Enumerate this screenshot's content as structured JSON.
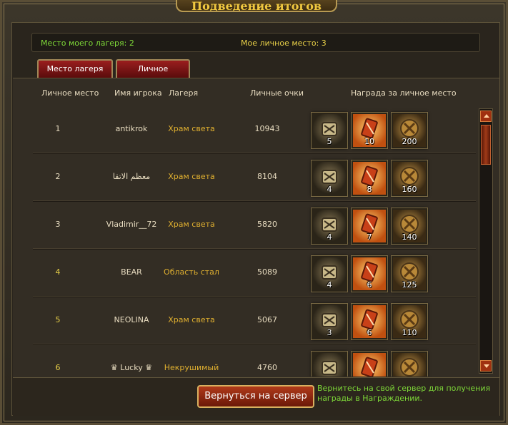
{
  "window": {
    "title": "Подведение итогов"
  },
  "info": {
    "camp_place": "Место моего лагеря: 2",
    "personal_place": "Мое личное место: 3"
  },
  "tabs": [
    {
      "label": "Место лагеря"
    },
    {
      "label": "Личное место"
    }
  ],
  "headers": {
    "place": "Личное место",
    "player": "Имя игрока",
    "camp": "Лагеря",
    "score": "Личные очки",
    "reward": "Награда за личное место"
  },
  "rows": [
    {
      "place": "1",
      "player": "antikrok",
      "camp": "Храм света",
      "score": "10943",
      "rewards": [
        "5",
        "10",
        "200"
      ]
    },
    {
      "place": "2",
      "player": "معظم الاتقا",
      "camp": "Храм света",
      "score": "8104",
      "rewards": [
        "4",
        "8",
        "160"
      ]
    },
    {
      "place": "3",
      "player": "Vladimir__72",
      "camp": "Храм света",
      "score": "5820",
      "rewards": [
        "4",
        "7",
        "140"
      ]
    },
    {
      "place": "4",
      "player": "BEAR",
      "camp": "Область стал",
      "score": "5089",
      "rewards": [
        "4",
        "6",
        "125"
      ]
    },
    {
      "place": "5",
      "player": "NEOLINA",
      "camp": "Храм света",
      "score": "5067",
      "rewards": [
        "3",
        "6",
        "110"
      ]
    },
    {
      "place": "6",
      "player": "♛ Lucky ♛",
      "camp": "Некрушимый",
      "score": "4760",
      "rewards": [
        "",
        "",
        ""
      ]
    }
  ],
  "footer": {
    "return_button": "Вернуться на сервер",
    "note": "Вернитесь на свой сервер для получения награды в Награждении."
  },
  "colors": {
    "green_text": "#7ed838",
    "gold_text": "#e8d048",
    "camp_text": "#e0b030"
  }
}
